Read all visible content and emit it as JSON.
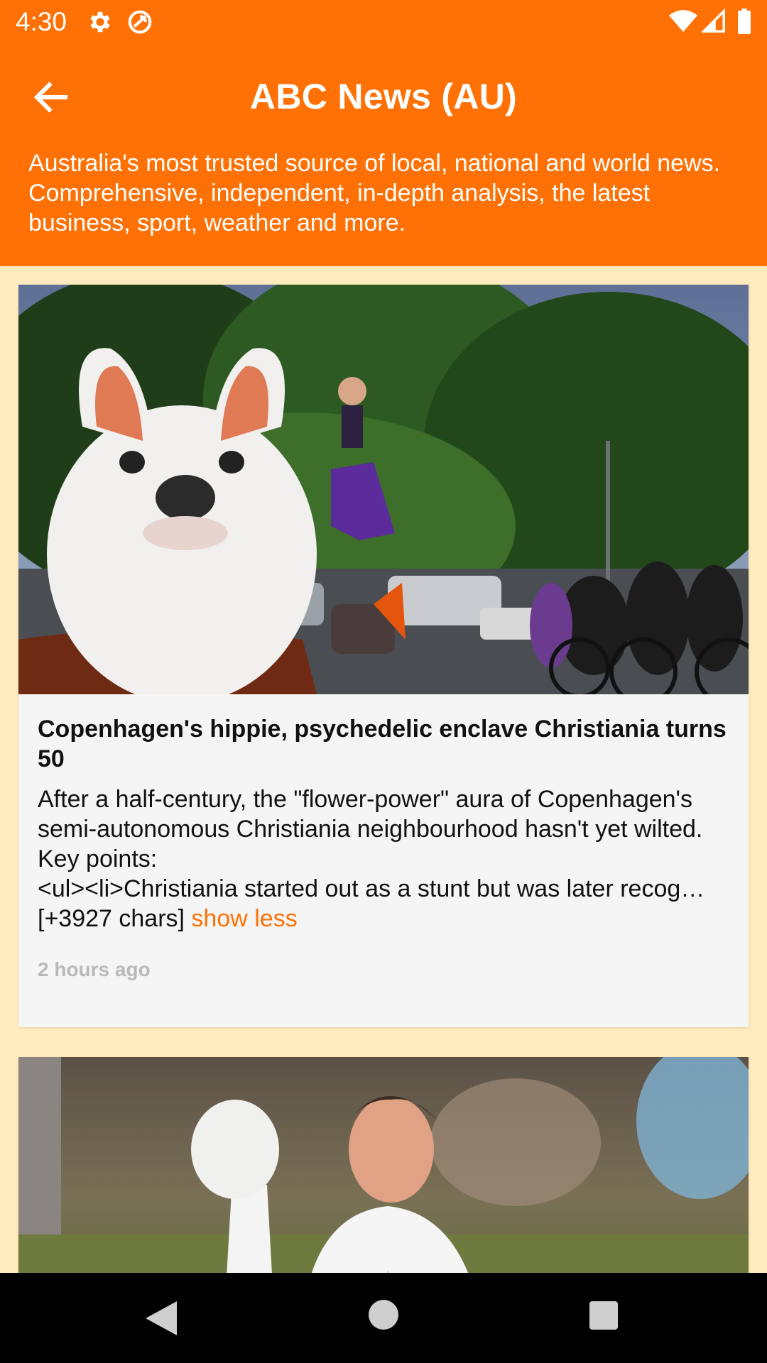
{
  "status_bar": {
    "time": "4:30",
    "icons": [
      "gear-icon",
      "sync-icon",
      "wifi-icon",
      "signal-icon",
      "battery-icon"
    ]
  },
  "app_bar": {
    "title": "ABC News (AU)",
    "description": "Australia's most trusted source of local, national and world news. Comprehensive, independent, in-depth analysis, the latest business, sport, weather and more.",
    "back_icon": "arrow-left-icon"
  },
  "articles": [
    {
      "title": "Copenhagen's hippie, psychedelic enclave Christiania turns 50",
      "description": "After a half-century, the \"flower-power\" aura of Copenhagen's semi-autonomous Christiania neighbourhood hasn't yet wilted.\nKey points:\n<ul><li>Christiania started out as a stunt but was later recog… [+3927 chars] ",
      "toggle_label": "show less",
      "time": "2 hours ago"
    },
    {
      "title": "",
      "description": "",
      "time": ""
    }
  ],
  "colors": {
    "primary": "#FF7105",
    "background": "#FFEBBD",
    "card": "#F5F5F5",
    "muted_text": "#B9B9B9"
  },
  "nav_bar": {
    "icons": [
      "nav-back-icon",
      "nav-home-icon",
      "nav-recents-icon"
    ]
  }
}
